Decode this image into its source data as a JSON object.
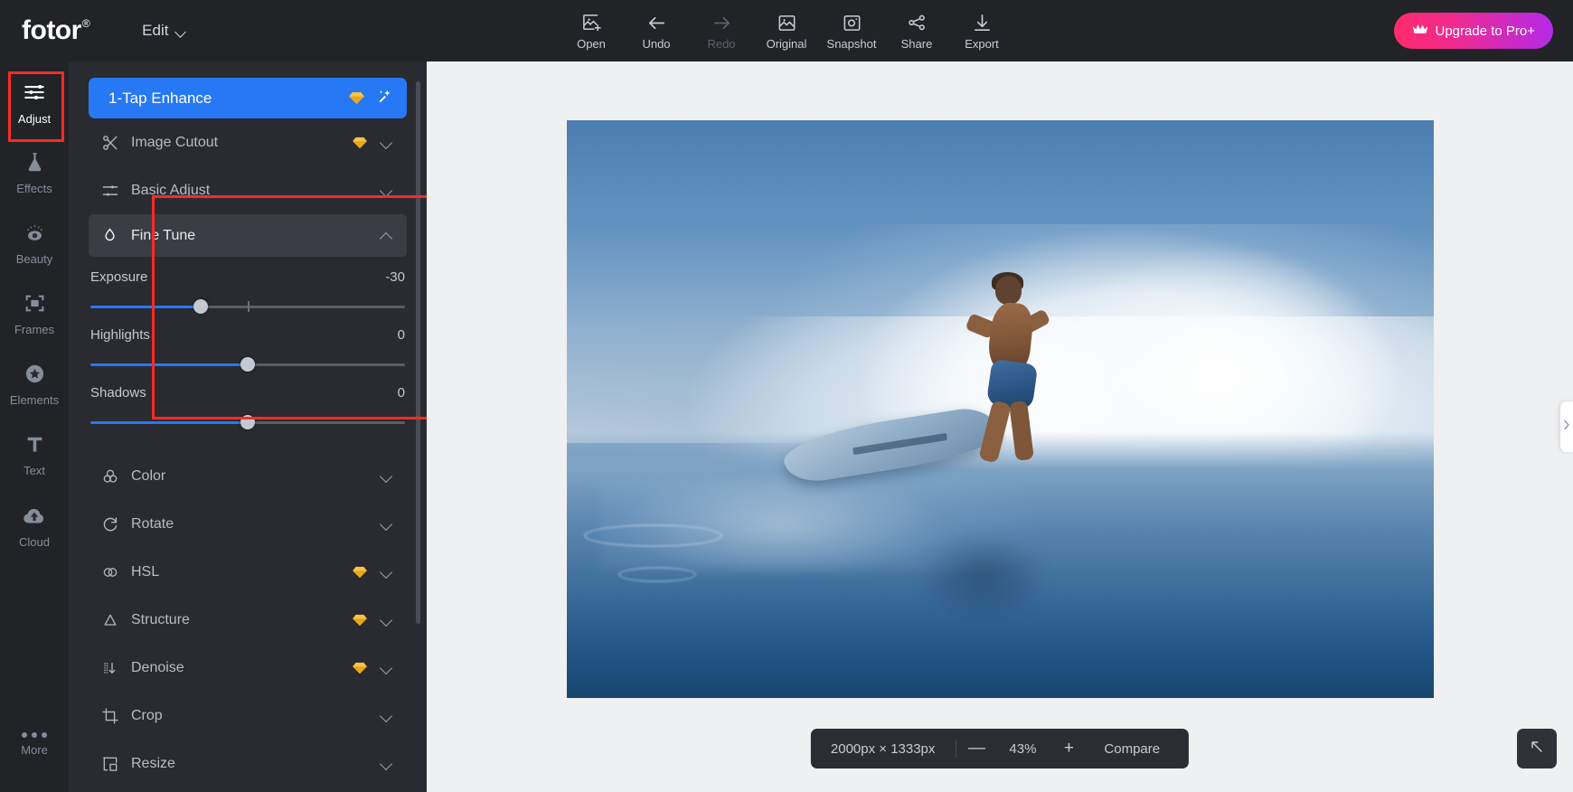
{
  "app": {
    "brand": "fotor",
    "brand_mark": "®",
    "menu": "Edit"
  },
  "toolbar": {
    "items": [
      {
        "label": "Open",
        "icon": "image-add-icon",
        "disabled": false
      },
      {
        "label": "Undo",
        "icon": "arrow-left-icon",
        "disabled": false
      },
      {
        "label": "Redo",
        "icon": "arrow-right-icon",
        "disabled": true
      },
      {
        "label": "Original",
        "icon": "image-icon",
        "disabled": false
      },
      {
        "label": "Snapshot",
        "icon": "camera-icon",
        "disabled": false
      },
      {
        "label": "Share",
        "icon": "share-icon",
        "disabled": false
      },
      {
        "label": "Export",
        "icon": "download-icon",
        "disabled": false
      }
    ],
    "upgrade_label": "Upgrade to Pro+",
    "upgrade_icon": "crown-icon"
  },
  "sidebar": {
    "items": [
      {
        "label": "Adjust",
        "icon": "sliders-icon",
        "active": true
      },
      {
        "label": "Effects",
        "icon": "flask-icon",
        "active": false
      },
      {
        "label": "Beauty",
        "icon": "eye-icon",
        "active": false
      },
      {
        "label": "Frames",
        "icon": "frame-icon",
        "active": false
      },
      {
        "label": "Elements",
        "icon": "star-icon",
        "active": false
      },
      {
        "label": "Text",
        "icon": "text-t-icon",
        "active": false
      },
      {
        "label": "Cloud",
        "icon": "cloud-up-icon",
        "active": false
      }
    ],
    "more_label": "More",
    "more_icon": "ellipsis-icon"
  },
  "panel": {
    "primary": {
      "label": "1-Tap Enhance",
      "gem_icon": "gem-icon",
      "wand_icon": "magic-wand-icon"
    },
    "rows": [
      {
        "label": "Image Cutout",
        "icon": "scissors-icon",
        "gem": true,
        "state": "collapsed"
      },
      {
        "label": "Basic Adjust",
        "icon": "sliders-icon",
        "gem": false,
        "state": "collapsed"
      }
    ],
    "fine_tune": {
      "label": "Fine Tune",
      "icon": "droplet-icon",
      "state": "expanded",
      "sliders": [
        {
          "label": "Exposure",
          "value": "-30",
          "fill_pct": 33,
          "thumb_pct": 35,
          "has_tick": true,
          "tick_pct": 50
        },
        {
          "label": "Highlights",
          "value": "0",
          "fill_pct": 49,
          "thumb_pct": 50,
          "has_tick": false,
          "tick_pct": 50
        },
        {
          "label": "Shadows",
          "value": "0",
          "fill_pct": 49,
          "thumb_pct": 50,
          "has_tick": false,
          "tick_pct": 50
        }
      ]
    },
    "rows_after": [
      {
        "label": "Color",
        "icon": "color-circles-icon",
        "gem": false,
        "state": "collapsed"
      },
      {
        "label": "Rotate",
        "icon": "rotate-icon",
        "gem": false,
        "state": "collapsed"
      },
      {
        "label": "HSL",
        "icon": "hsl-icon",
        "gem": true,
        "state": "collapsed"
      },
      {
        "label": "Structure",
        "icon": "triangle-icon",
        "gem": true,
        "state": "collapsed"
      },
      {
        "label": "Denoise",
        "icon": "denoise-icon",
        "gem": true,
        "state": "collapsed"
      },
      {
        "label": "Crop",
        "icon": "crop-icon",
        "gem": false,
        "state": "collapsed"
      },
      {
        "label": "Resize",
        "icon": "resize-icon",
        "gem": false,
        "state": "collapsed"
      }
    ]
  },
  "statusbar": {
    "dimensions": "2000px × 1333px",
    "zoom_out_label": "—",
    "zoom_level": "43%",
    "zoom_in_label": "+",
    "compare_label": "Compare"
  },
  "canvas": {
    "expand_icon": "arrow-up-left-icon",
    "edge_handle_icon": "chevron-right-icon"
  },
  "colors": {
    "accent_blue": "#2778f5",
    "annotation_red": "#ff2a24",
    "gem_gold": "#f5b731",
    "topbar_bg": "#212327",
    "panel_bg": "#292b30",
    "canvas_bg": "#eff0f2"
  }
}
